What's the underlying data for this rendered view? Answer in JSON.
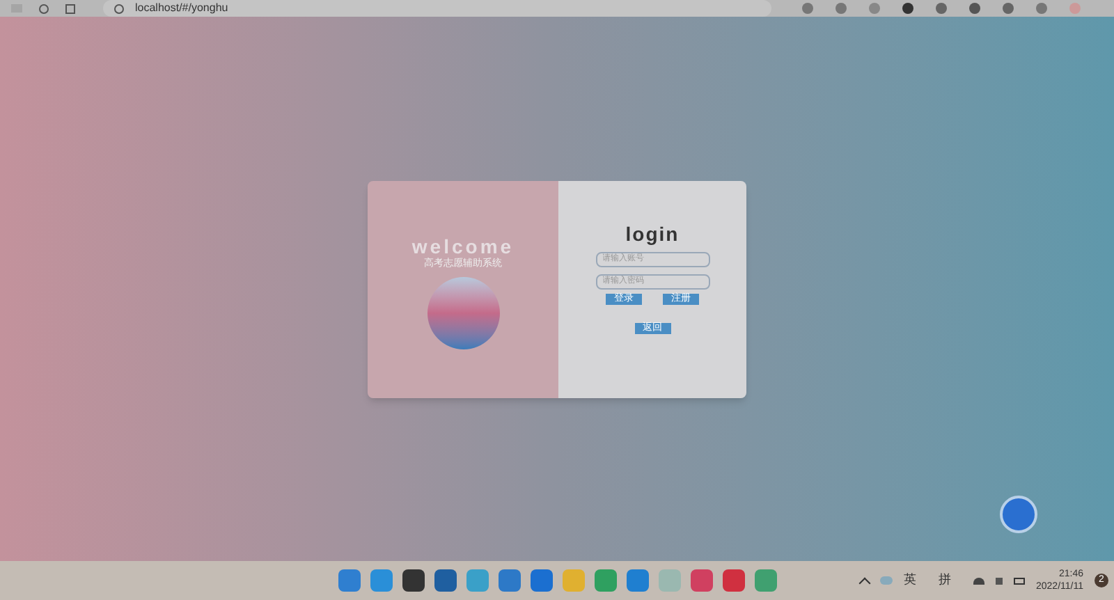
{
  "browser": {
    "url": "localhost/#/yonghu"
  },
  "login_card": {
    "welcome": "welcome",
    "subtitle": "高考志愿辅助系统",
    "title": "login",
    "fields": [
      {
        "placeholder": "请输入账号"
      },
      {
        "placeholder": "请输入密码"
      }
    ],
    "buttons": [
      "登录",
      "注册"
    ],
    "back_button": "返回"
  },
  "taskbar": {
    "input_language": "英",
    "input_method": "拼",
    "time": "21:46",
    "date": "2022/11/11",
    "notification_count": "2"
  }
}
